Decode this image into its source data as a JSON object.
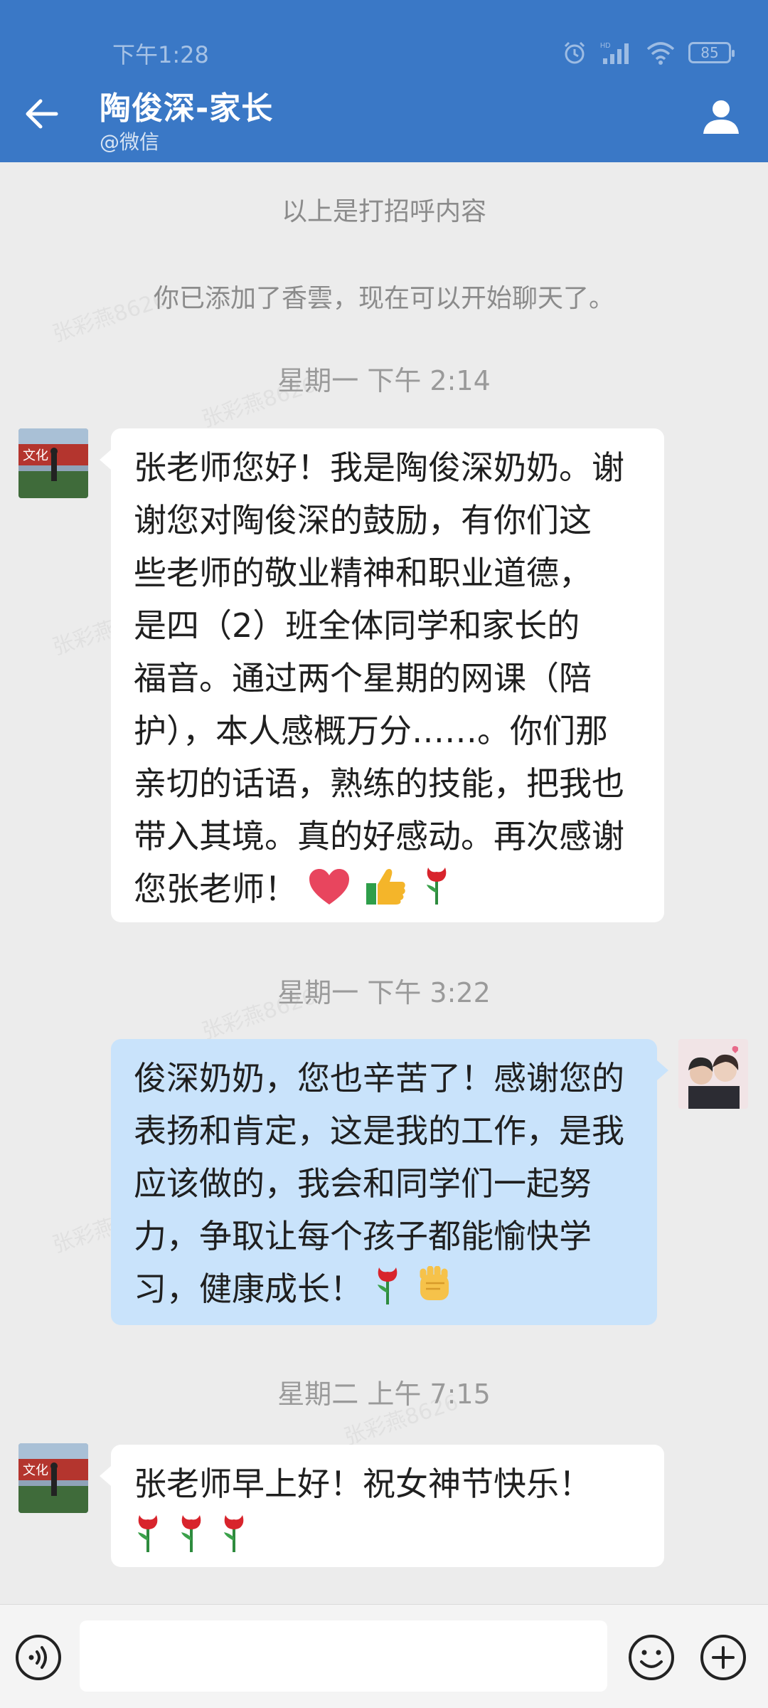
{
  "status_bar": {
    "time": "下午1:28",
    "battery": "85"
  },
  "header": {
    "title": "陶俊深-家长",
    "subtitle": "@微信"
  },
  "system_messages": [
    "以上是打招呼内容",
    "你已添加了香雲，现在可以开始聊天了。"
  ],
  "timestamps": [
    "星期一  下午 2:14",
    "星期一  下午 3:22",
    "星期二  上午 7:15"
  ],
  "messages": [
    {
      "side": "left",
      "lines": [
        "张老师您好！我是陶俊深奶奶。谢",
        "谢您对陶俊深的鼓励，有你们这",
        "些老师的敬业精神和职业道德，",
        "是四（2）班全体同学和家长的",
        "福音。通过两个星期的网课（陪",
        "护），本人感概万分……。你们那",
        "亲切的话语，熟练的技能，把我也",
        "带入其境。真的好感动。再次感谢",
        "您张老师！"
      ],
      "emojis": [
        "heart",
        "thumbs-up",
        "rose"
      ]
    },
    {
      "side": "right",
      "lines": [
        "俊深奶奶，您也辛苦了！感谢您的",
        "表扬和肯定，这是我的工作，是我",
        "应该做的，我会和同学们一起努",
        "力，争取让每个孩子都能愉快学",
        "习，健康成长！"
      ],
      "emojis": [
        "rose",
        "raised-fist"
      ]
    },
    {
      "side": "left",
      "lines": [
        "张老师早上好！祝女神节快乐！"
      ],
      "emojis": [
        "rose",
        "rose",
        "rose"
      ]
    }
  ],
  "watermark": "张彩燕8626",
  "colors": {
    "header": "#3a78c6",
    "left_bubble": "#ffffff",
    "right_bubble": "#c9e3fb",
    "background": "#ececec"
  }
}
